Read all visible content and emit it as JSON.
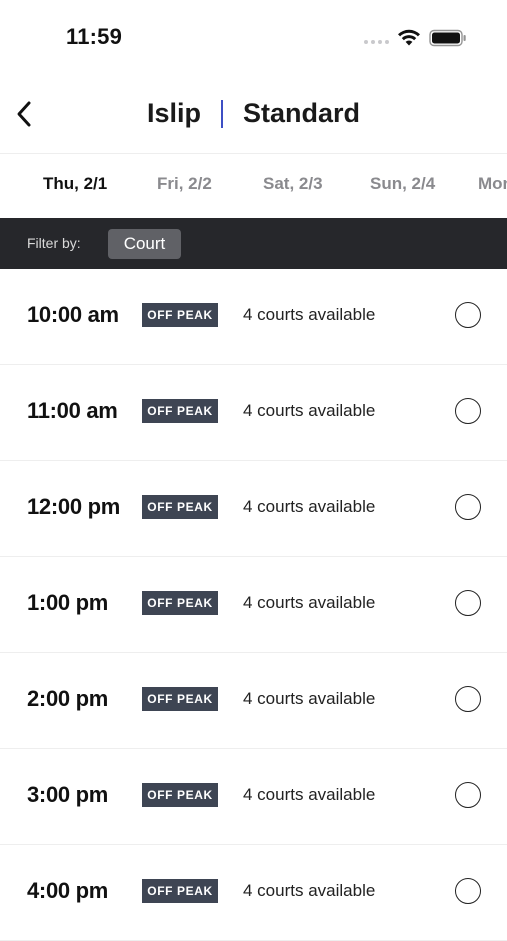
{
  "status_bar": {
    "time": "11:59"
  },
  "header": {
    "location": "Islip",
    "court_type": "Standard"
  },
  "date_tabs": [
    {
      "label": "Thu, 2/1",
      "active": true
    },
    {
      "label": "Fri, 2/2",
      "active": false
    },
    {
      "label": "Sat, 2/3",
      "active": false
    },
    {
      "label": "Sun, 2/4",
      "active": false
    },
    {
      "label": "Mon",
      "active": false
    }
  ],
  "filter": {
    "label": "Filter by:",
    "chip": "Court"
  },
  "slots": [
    {
      "time": "10:00 am",
      "badge": "OFF PEAK",
      "availability": "4 courts available"
    },
    {
      "time": "11:00 am",
      "badge": "OFF PEAK",
      "availability": "4 courts available"
    },
    {
      "time": "12:00 pm",
      "badge": "OFF PEAK",
      "availability": "4 courts available"
    },
    {
      "time": "1:00 pm",
      "badge": "OFF PEAK",
      "availability": "4 courts available"
    },
    {
      "time": "2:00 pm",
      "badge": "OFF PEAK",
      "availability": "4 courts available"
    },
    {
      "time": "3:00 pm",
      "badge": "OFF PEAK",
      "availability": "4 courts available"
    },
    {
      "time": "4:00 pm",
      "badge": "OFF PEAK",
      "availability": "4 courts available"
    }
  ],
  "colors": {
    "accent_divider": "#3d4fc4",
    "filter_bar_bg": "#26272b",
    "badge_bg": "#3e4553"
  },
  "icons": {
    "back": "chevron-left-icon",
    "wifi": "wifi-icon",
    "battery": "battery-icon",
    "signal": "signal-dots-icon",
    "radio": "radio-unselected-icon"
  }
}
